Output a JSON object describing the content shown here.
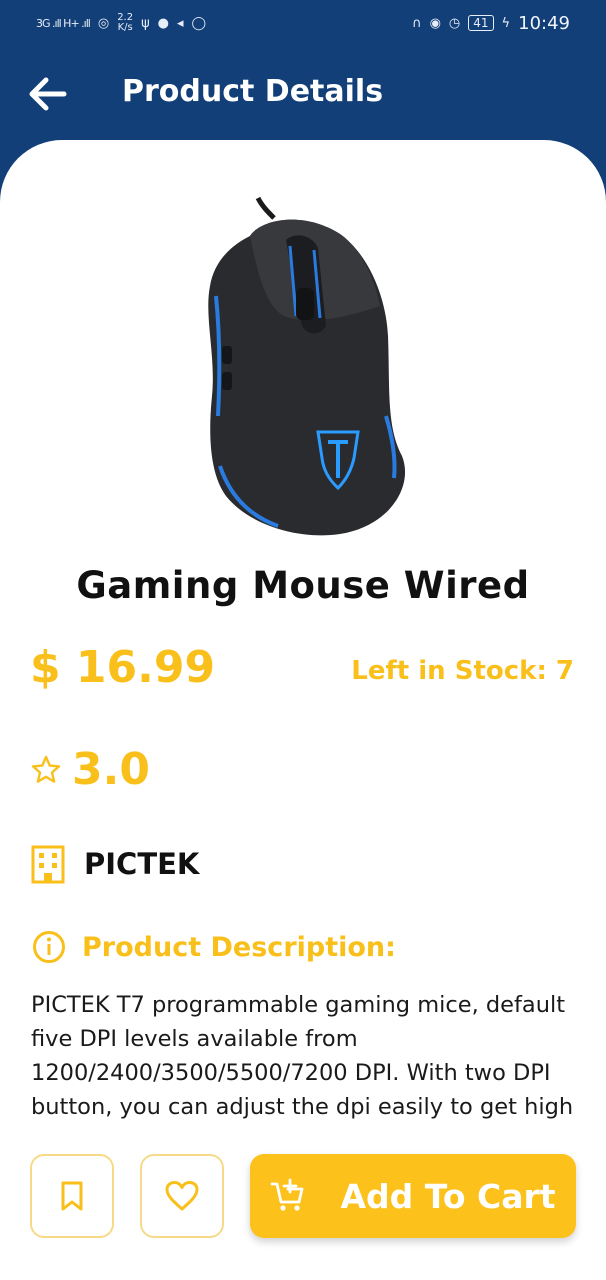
{
  "status_bar": {
    "signal_text": "3G .ıll H+ .ıll",
    "data_speed_top": "2.2",
    "data_speed_bottom": "K/s",
    "battery": "41",
    "time": "10:49",
    "left_icons": [
      "signal-icon",
      "wifi-icon",
      "usb-icon",
      "app-icon",
      "telegram-icon",
      "whatsapp-icon"
    ],
    "right_icons": [
      "headphones-icon",
      "eye-icon",
      "alarm-icon",
      "battery-icon",
      "charging-icon"
    ]
  },
  "app_bar": {
    "title": "Product Details",
    "back_icon": "arrow-left-icon"
  },
  "product": {
    "name": "Gaming Mouse Wired",
    "price": "$ 16.99",
    "stock_text": "Left in Stock: 7",
    "rating": "3.0",
    "brand": "PICTEK",
    "description_title": "Product Description:",
    "description": "PICTEK T7 programmable gaming mice, default five DPI levels available from 1200/2400/3500/5500/7200 DPI. With two DPI button, you can adjust the dpi easily to get high accuracy and consistent precision for different needs."
  },
  "actions": {
    "add_to_cart_label": "Add To Cart"
  },
  "colors": {
    "primary": "#123f78",
    "accent": "#fcc11a",
    "accent_text": "#f9bf1a",
    "border": "#f6d98a"
  }
}
